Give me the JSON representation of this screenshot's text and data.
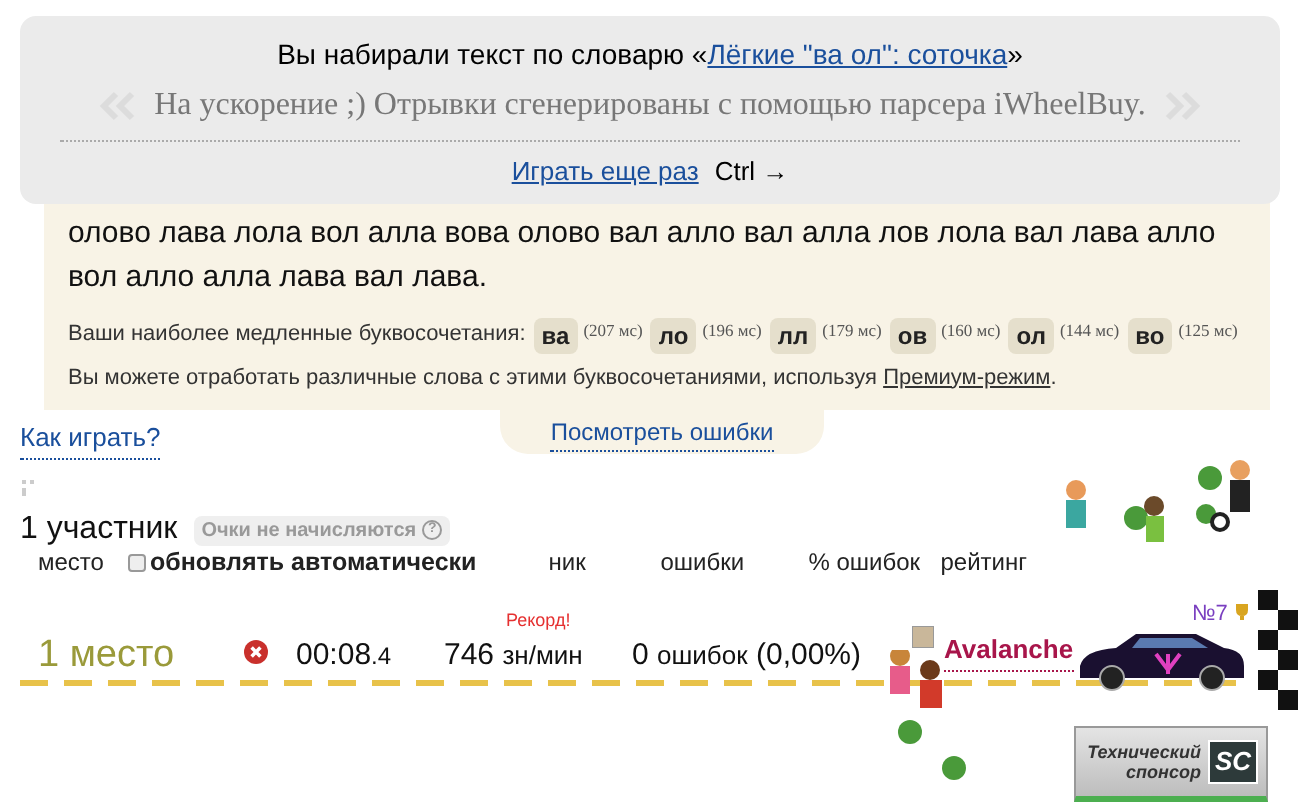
{
  "summary": {
    "intro": "Вы набирали текст по словарю «",
    "dictionary_link": "Лёгкие \"ва ол\": соточка",
    "intro_end": "»",
    "description": "На ускорение ;) Отрывки сгенерированы с помощью парсера iWheelBuy.",
    "play_again": "Играть еще раз",
    "shortcut": "Ctrl →"
  },
  "text_panel": {
    "typed_text": "олово лава лола вол алла вова олово вал алло вал алла лов лола вал лава алло вол алло алла лава вал лава.",
    "slow_label": "Ваши наиболее медленные буквосочетания:",
    "slow_combos": [
      {
        "combo": "ва",
        "time": "(207 мс)"
      },
      {
        "combo": "ло",
        "time": "(196 мс)"
      },
      {
        "combo": "лл",
        "time": "(179 мс)"
      },
      {
        "combo": "ов",
        "time": "(160 мс)"
      },
      {
        "combo": "ол",
        "time": "(144 мс)"
      },
      {
        "combo": "во",
        "time": "(125 мс)"
      }
    ],
    "practice_text": "Вы можете отработать различные слова с этими буквосочетаниями, используя",
    "premium_link": "Премиум-режим",
    "practice_end": "."
  },
  "how_to_play": "Как играть?",
  "view_errors": "Посмотреть ошибки",
  "participants": {
    "count": "1 участник",
    "points_badge": "Очки не начисляются",
    "help_icon": "?",
    "place_header": "место",
    "auto_update": {
      "label": "обновлять автоматически",
      "checked": false
    },
    "columns": [
      "ник",
      "ошибки",
      "% ошибок",
      "рейтинг"
    ]
  },
  "result": {
    "place": "1 место",
    "time": "00:08",
    "time_fraction": ".4",
    "speed": "746",
    "speed_unit": "зн/мин",
    "record": "Рекорд!",
    "errors": "0",
    "errors_label": "ошибок",
    "errors_percent": "(0,00%)",
    "nick": "Avalanche",
    "car_number": "№7"
  },
  "sponsor": {
    "label": "Технический спонсор",
    "logo": "SC"
  }
}
